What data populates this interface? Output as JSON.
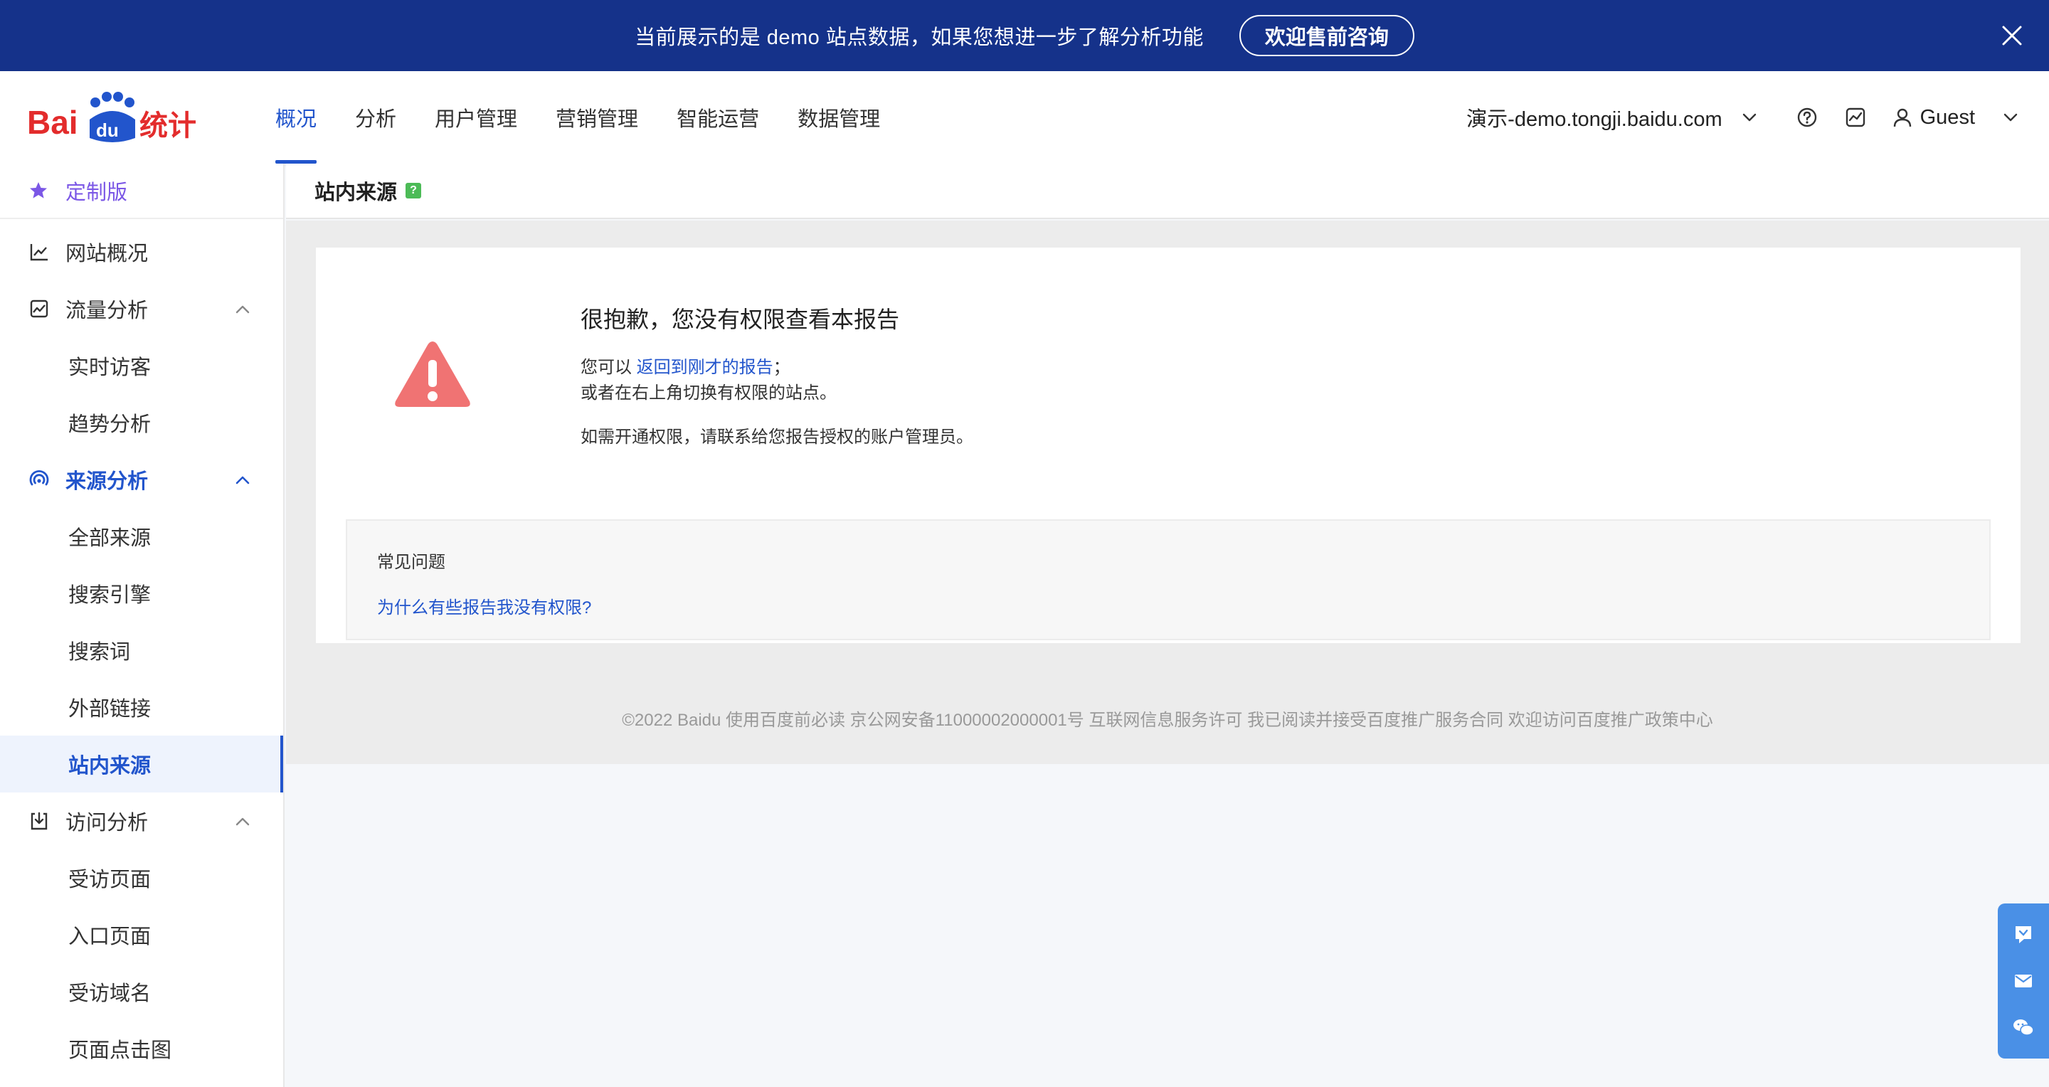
{
  "banner": {
    "text": "当前展示的是 demo 站点数据，如果您想进一步了解分析功能",
    "button_label": "欢迎售前咨询"
  },
  "header": {
    "logo_text": "Bai du 统计",
    "nav": [
      {
        "label": "概况",
        "active": true
      },
      {
        "label": "分析"
      },
      {
        "label": "用户管理"
      },
      {
        "label": "营销管理"
      },
      {
        "label": "智能运营"
      },
      {
        "label": "数据管理"
      }
    ],
    "site": "演示-demo.tongji.baidu.com",
    "user": "Guest"
  },
  "sidebar": {
    "custom": "定制版",
    "items": [
      {
        "label": "网站概况",
        "type": "group"
      },
      {
        "label": "流量分析",
        "type": "group"
      },
      {
        "label": "实时访客",
        "type": "sub"
      },
      {
        "label": "趋势分析",
        "type": "sub"
      },
      {
        "label": "来源分析",
        "type": "group"
      },
      {
        "label": "全部来源",
        "type": "sub"
      },
      {
        "label": "搜索引擎",
        "type": "sub"
      },
      {
        "label": "搜索词",
        "type": "sub"
      },
      {
        "label": "外部链接",
        "type": "sub"
      },
      {
        "label": "站内来源",
        "type": "sub"
      },
      {
        "label": "访问分析",
        "type": "group"
      },
      {
        "label": "受访页面",
        "type": "sub"
      },
      {
        "label": "入口页面",
        "type": "sub"
      },
      {
        "label": "受访域名",
        "type": "sub"
      },
      {
        "label": "页面点击图",
        "type": "sub"
      }
    ]
  },
  "page": {
    "title": "站内来源",
    "help": "?"
  },
  "message": {
    "title": "很抱歉，您没有权限查看本报告",
    "line1_prefix": "您可以 ",
    "line1_link": "返回到刚才的报告",
    "line1_suffix": "；",
    "line2": "或者在右上角切换有权限的站点。",
    "line3": "如需开通权限，请联系给您报告授权的账户管理员。"
  },
  "faq": {
    "title": "常见问题",
    "link": "为什么有些报告我没有权限?"
  },
  "footer": {
    "text": "©2022 Baidu 使用百度前必读 京公网安备11000002000001号 互联网信息服务许可 我已阅读并接受百度推广服务合同 欢迎访问百度推广政策中心"
  },
  "colors": {
    "banner": "#15328a",
    "accent": "#2255cc",
    "custom": "#7b57e6",
    "warning": "#f07373"
  }
}
